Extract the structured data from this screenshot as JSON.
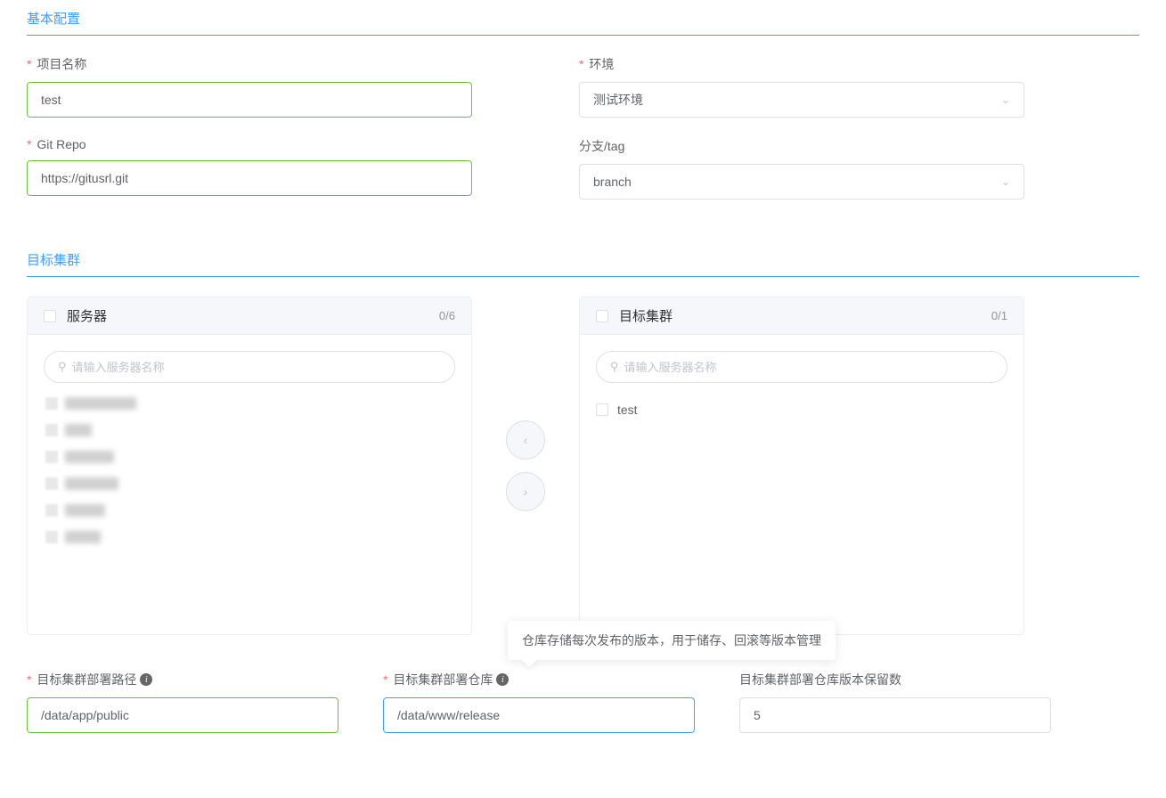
{
  "sections": {
    "basic": "基本配置",
    "cluster": "目标集群"
  },
  "form": {
    "project_name": {
      "label": "项目名称",
      "value": "test"
    },
    "env": {
      "label": "环境",
      "value": "测试环境"
    },
    "git_repo": {
      "label": "Git Repo",
      "value": "https://gitusrl.git"
    },
    "branch_tag": {
      "label": "分支/tag",
      "value": "branch"
    }
  },
  "transfer": {
    "left": {
      "title": "服务器",
      "count": "0/6",
      "search_placeholder": "请输入服务器名称"
    },
    "right": {
      "title": "目标集群",
      "count": "0/1",
      "search_placeholder": "请输入服务器名称",
      "items": [
        "test"
      ]
    }
  },
  "deploy": {
    "path": {
      "label": "目标集群部署路径",
      "value": "/data/app/public"
    },
    "repo": {
      "label": "目标集群部署仓库",
      "value": "/data/www/release",
      "tooltip": "仓库存储每次发布的版本，用于储存、回滚等版本管理"
    },
    "keep": {
      "label": "目标集群部署仓库版本保留数",
      "value": "5"
    }
  }
}
